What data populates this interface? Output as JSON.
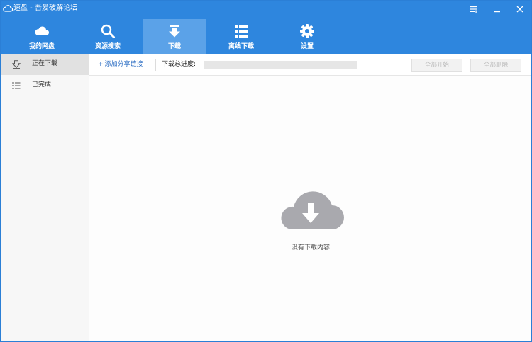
{
  "app": {
    "title": "速盘 - 吾爱破解论坛",
    "accent_color": "#2e86de",
    "active_tab_color": "#5ba2e8"
  },
  "window_controls": {
    "menu_icon": "menu-icon",
    "minimize_icon": "minimize-icon",
    "close_icon": "close-icon"
  },
  "nav": {
    "tabs": [
      {
        "label": "我的网盘",
        "icon": "cloud-icon",
        "active": false
      },
      {
        "label": "资源搜索",
        "icon": "search-icon",
        "active": false
      },
      {
        "label": "下载",
        "icon": "download-icon",
        "active": true
      },
      {
        "label": "离线下载",
        "icon": "list-icon",
        "active": false
      },
      {
        "label": "设置",
        "icon": "gear-icon",
        "active": false
      }
    ]
  },
  "sidebar": {
    "items": [
      {
        "label": "正在下载",
        "icon": "downloading-icon",
        "active": true
      },
      {
        "label": "已完成",
        "icon": "completed-list-icon",
        "active": false
      }
    ]
  },
  "toolbar": {
    "add_link_label": "添加分享链接",
    "progress_label": "下载总进度:",
    "progress": 0,
    "start_all_label": "全部开始",
    "delete_all_label": "全部删除"
  },
  "main": {
    "empty_icon": "cloud-download-icon",
    "empty_message": "没有下载内容"
  }
}
